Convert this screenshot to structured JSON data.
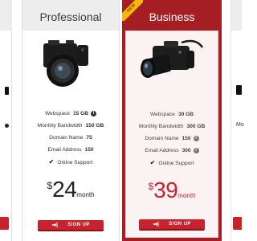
{
  "ribbon": "NEW",
  "plans": [
    {
      "name": "Professional",
      "specs": [
        {
          "label": "Webspace",
          "value": "15 GB",
          "info": true
        },
        {
          "label": "Monthly Bandwidth",
          "value": "150 GB",
          "info": false
        },
        {
          "label": "Domain Name",
          "value": "75",
          "info": false
        },
        {
          "label": "Email Address",
          "value": "150",
          "info": false
        }
      ],
      "support": "Online Support",
      "currency": "$",
      "amount": "24",
      "period": "month",
      "cta": "SIGN UP"
    },
    {
      "name": "Business",
      "specs": [
        {
          "label": "Webspace",
          "value": "30 GB",
          "info": false
        },
        {
          "label": "Monthly Bandwidth",
          "value": "300 GB",
          "info": false
        },
        {
          "label": "Domain Name",
          "value": "150",
          "info": true
        },
        {
          "label": "Email Address",
          "value": "300",
          "info": true
        }
      ],
      "support": "Online Support",
      "currency": "$",
      "amount": "39",
      "period": "month",
      "cta": "SIGN UP"
    }
  ],
  "right_partial_text": "Mo",
  "colors": {
    "accent_red": "#c8232c",
    "business_bg": "#a51e23",
    "ribbon_yellow": "#f5b80b",
    "header_gray": "#ededed"
  }
}
